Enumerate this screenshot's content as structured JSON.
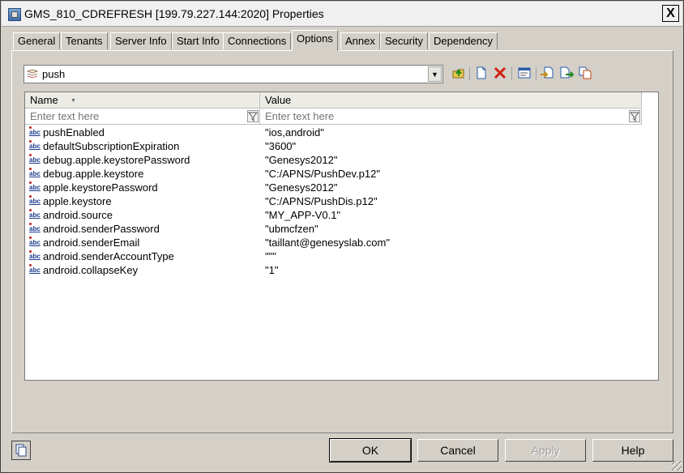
{
  "window": {
    "title": "GMS_810_CDREFRESH [199.79.227.144:2020] Properties",
    "close_label": "X"
  },
  "tabs": [
    {
      "label": "General"
    },
    {
      "label": "Tenants"
    },
    {
      "label": "Server Info"
    },
    {
      "label": "Start Info"
    },
    {
      "label": "Connections"
    },
    {
      "label": "Options",
      "active": true
    },
    {
      "label": "Annex"
    },
    {
      "label": "Security"
    },
    {
      "label": "Dependency"
    }
  ],
  "section_selector": {
    "value": "push"
  },
  "toolbar": {
    "icons": [
      "up-folder-icon",
      "new-icon",
      "delete-icon",
      "edit-icon",
      "import-icon",
      "export-icon",
      "copy-icon"
    ]
  },
  "grid": {
    "columns": {
      "name": "Name",
      "value": "Value"
    },
    "filter_placeholder": "Enter text here",
    "rows": [
      {
        "name": "pushEnabled",
        "value": "\"ios,android\""
      },
      {
        "name": "defaultSubscriptionExpiration",
        "value": "\"3600\""
      },
      {
        "name": "debug.apple.keystorePassword",
        "value": "\"Genesys2012\""
      },
      {
        "name": "debug.apple.keystore",
        "value": "\"C:/APNS/PushDev.p12\""
      },
      {
        "name": "apple.keystorePassword",
        "value": "\"Genesys2012\""
      },
      {
        "name": "apple.keystore",
        "value": "\"C:/APNS/PushDis.p12\""
      },
      {
        "name": "android.source",
        "value": "\"MY_APP-V0.1\""
      },
      {
        "name": "android.senderPassword",
        "value": "\"ubmcfzen\""
      },
      {
        "name": "android.senderEmail",
        "value": "\"taillant@genesyslab.com\""
      },
      {
        "name": "android.senderAccountType",
        "value": "\"\"\""
      },
      {
        "name": "android.collapseKey",
        "value": "\"1\""
      }
    ]
  },
  "buttons": {
    "ok": "OK",
    "cancel": "Cancel",
    "apply": "Apply",
    "help": "Help"
  }
}
